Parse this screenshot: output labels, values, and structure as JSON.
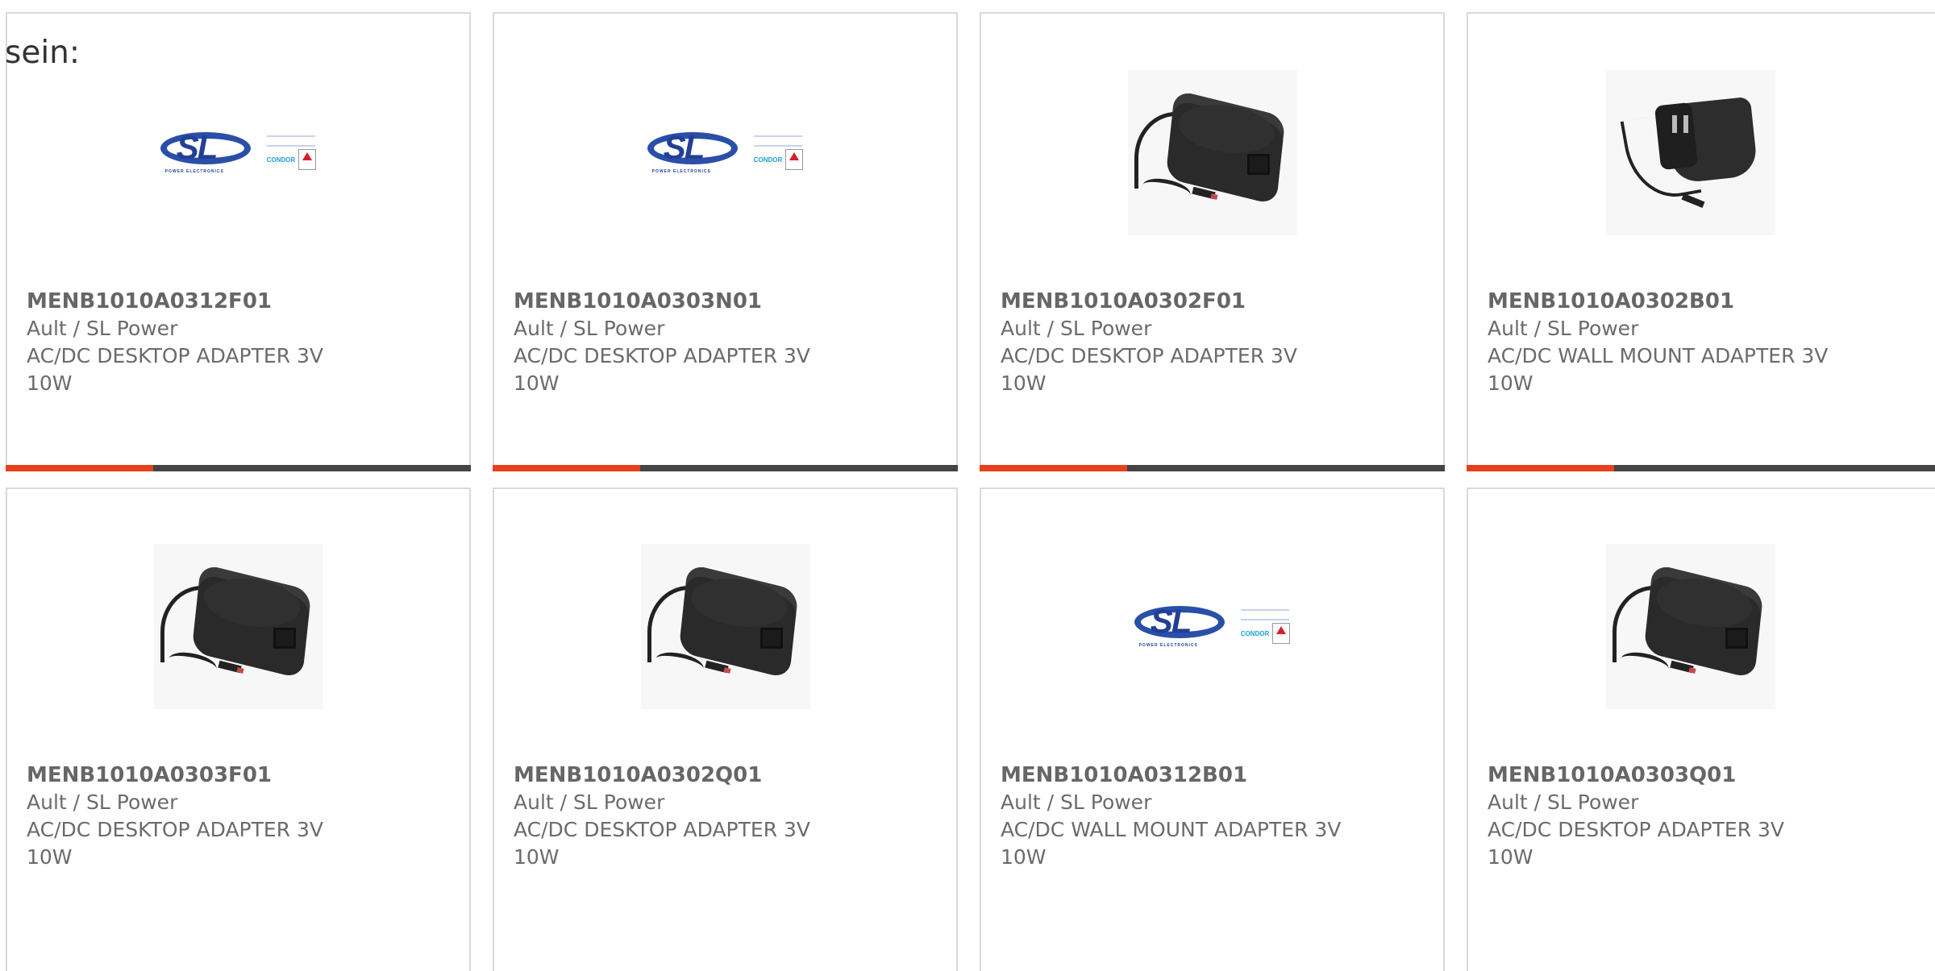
{
  "intro_text": "sein:",
  "accent_color": "#e8401c",
  "bar_color": "#444444",
  "products": [
    {
      "part": "MENB1010A0312F01",
      "maker": "Ault / SL Power",
      "desc": "AC/DC DESKTOP ADAPTER 3V 10W",
      "image": "sl-power-logo"
    },
    {
      "part": "MENB1010A0303N01",
      "maker": "Ault / SL Power",
      "desc": "AC/DC DESKTOP ADAPTER 3V 10W",
      "image": "sl-power-logo"
    },
    {
      "part": "MENB1010A0302F01",
      "maker": "Ault / SL Power",
      "desc": "AC/DC DESKTOP ADAPTER 3V 10W",
      "image": "desktop-adapter-photo"
    },
    {
      "part": "MENB1010A0302B01",
      "maker": "Ault / SL Power",
      "desc": "AC/DC WALL MOUNT ADAPTER 3V 10W",
      "image": "wall-adapter-photo"
    },
    {
      "part": "MENB1010A0303F01",
      "maker": "Ault / SL Power",
      "desc": "AC/DC DESKTOP ADAPTER 3V 10W",
      "image": "desktop-adapter-photo"
    },
    {
      "part": "MENB1010A0302Q01",
      "maker": "Ault / SL Power",
      "desc": "AC/DC DESKTOP ADAPTER 3V 10W",
      "image": "desktop-adapter-photo"
    },
    {
      "part": "MENB1010A0312B01",
      "maker": "Ault / SL Power",
      "desc": "AC/DC WALL MOUNT ADAPTER 3V 10W",
      "image": "sl-power-logo"
    },
    {
      "part": "MENB1010A0303Q01",
      "maker": "Ault / SL Power",
      "desc": "AC/DC DESKTOP ADAPTER 3V 10W",
      "image": "desktop-adapter-photo"
    }
  ],
  "logo": {
    "mark": "SL",
    "subtitle": "POWER ELECTRONICS",
    "brand": "CONDOR"
  }
}
